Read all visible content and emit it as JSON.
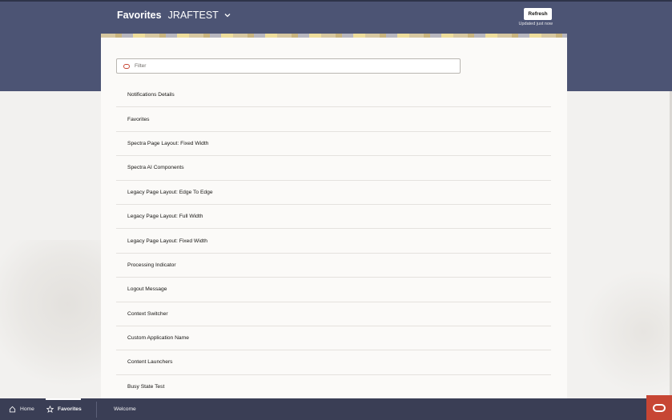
{
  "header": {
    "title": "Favorites",
    "context": "JRAFTEST",
    "refresh_label": "Refresh",
    "updated_text": "Updated just now"
  },
  "filter": {
    "placeholder": "Filter",
    "value": ""
  },
  "list": [
    "Notifications Details",
    "Favorites",
    "Spectra Page Layout: Fixed Width",
    "Spectra AI Components",
    "Legacy Page Layout: Edge To Edge",
    "Legacy Page Layout: Full Width",
    "Legacy Page Layout: Fixed Width",
    "Processing Indicator",
    "Logout Message",
    "Context Switcher",
    "Custom Application Name",
    "Content Launchers",
    "Busy State Test"
  ],
  "nav": {
    "home": "Home",
    "favorites": "Favorites",
    "welcome": "Welcome"
  },
  "colors": {
    "header": "#4c5474",
    "nav": "#3a3e55",
    "accent": "#c74634"
  },
  "icons": {
    "home": "home-icon",
    "favorites": "star-icon",
    "filter": "oracle-filter-icon",
    "context": "chevron-down-icon",
    "brand": "oracle-logo-icon"
  }
}
